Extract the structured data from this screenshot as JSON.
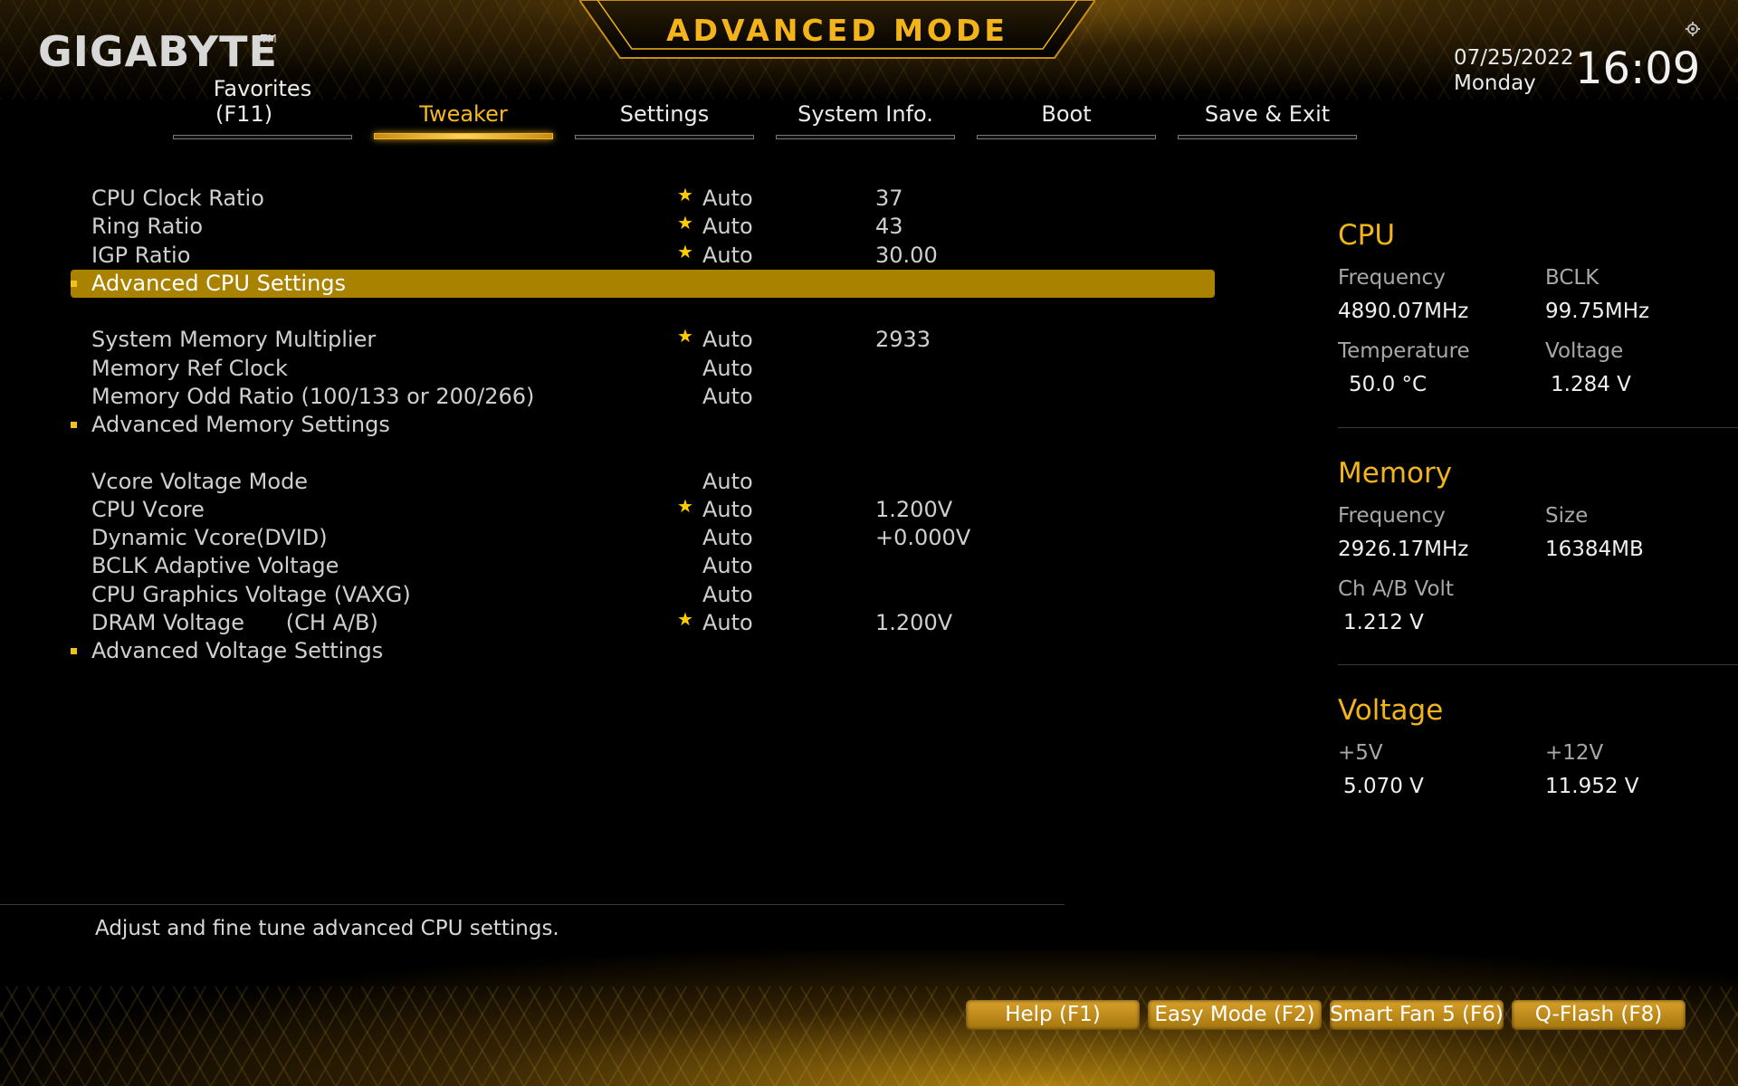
{
  "header": {
    "logo": "GIGABYTE",
    "logo_tm": "TM",
    "mode_title": "ADVANCED MODE",
    "date": "07/25/2022",
    "day": "Monday",
    "time": "16:09",
    "settings_icon": "gear-icon"
  },
  "tabs": [
    {
      "line1": "Favorites",
      "line2": "(F11)",
      "active": false
    },
    {
      "label": "Tweaker",
      "active": true
    },
    {
      "label": "Settings",
      "active": false
    },
    {
      "label": "System Info.",
      "active": false
    },
    {
      "label": "Boot",
      "active": false
    },
    {
      "label": "Save & Exit",
      "active": false
    }
  ],
  "settings": [
    {
      "name": "CPU Clock Ratio",
      "star": "★",
      "mode": "Auto",
      "value": "37"
    },
    {
      "name": "Ring Ratio",
      "star": "★",
      "mode": "Auto",
      "value": "43"
    },
    {
      "name": "IGP Ratio",
      "star": "★",
      "mode": "Auto",
      "value": "30.00"
    },
    {
      "name": "Advanced CPU Settings",
      "submenu": true,
      "selected": true
    },
    {
      "name": "System Memory Multiplier",
      "star": "★",
      "mode": "Auto",
      "value": "2933"
    },
    {
      "name": "Memory Ref Clock",
      "mode": "Auto"
    },
    {
      "name": "Memory Odd Ratio (100/133 or 200/266)",
      "mode": "Auto"
    },
    {
      "name": "Advanced Memory Settings",
      "submenu": true
    },
    {
      "name": "Vcore Voltage Mode",
      "mode": "Auto"
    },
    {
      "name": "CPU Vcore",
      "star": "★",
      "mode": "Auto",
      "value": "1.200V"
    },
    {
      "name": "Dynamic Vcore(DVID)",
      "mode": "Auto",
      "value": "+0.000V"
    },
    {
      "name": "BCLK Adaptive Voltage",
      "mode": "Auto"
    },
    {
      "name": "CPU Graphics Voltage (VAXG)",
      "mode": "Auto"
    },
    {
      "name": "DRAM Voltage      (CH A/B)",
      "star": "★",
      "mode": "Auto",
      "value": "1.200V"
    },
    {
      "name": "Advanced Voltage Settings",
      "submenu": true
    }
  ],
  "help_text": "Adjust and fine tune advanced CPU settings.",
  "monitor": {
    "cpu": {
      "title": "CPU",
      "frequency_label": "Frequency",
      "frequency": "4890.07MHz",
      "bclk_label": "BCLK",
      "bclk": "99.75MHz",
      "temperature_label": "Temperature",
      "temperature": "50.0 °C",
      "voltage_label": "Voltage",
      "voltage": "1.284 V"
    },
    "memory": {
      "title": "Memory",
      "frequency_label": "Frequency",
      "frequency": "2926.17MHz",
      "size_label": "Size",
      "size": "16384MB",
      "chab_label": "Ch A/B Volt",
      "chab": "1.212 V"
    },
    "voltage": {
      "title": "Voltage",
      "p5v_label": "+5V",
      "p5v": "5.070 V",
      "p12v_label": "+12V",
      "p12v": "11.952 V"
    }
  },
  "footer_buttons": [
    {
      "label": "Help (F1)"
    },
    {
      "label": "Easy Mode (F2)"
    },
    {
      "label": "Smart Fan 5 (F6)"
    },
    {
      "label": "Q-Flash (F8)"
    }
  ],
  "colors": {
    "accent": "#f2b419",
    "highlight": "#a98300",
    "background": "#000000"
  }
}
